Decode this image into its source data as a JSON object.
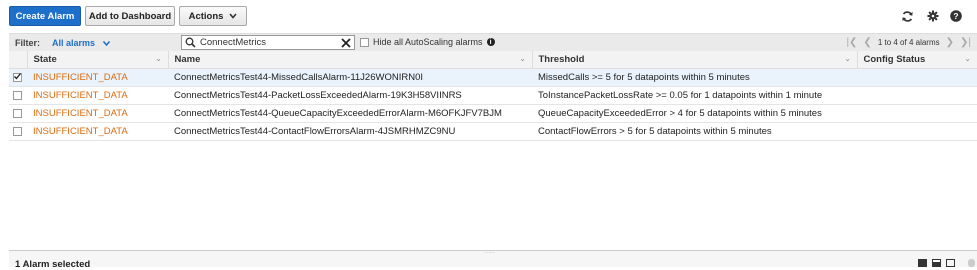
{
  "toolbar": {
    "create_alarm": "Create Alarm",
    "add_to_dashboard": "Add to Dashboard",
    "actions": "Actions",
    "icons": [
      "refresh-icon",
      "gear-icon",
      "help-icon"
    ]
  },
  "filter": {
    "label": "Filter:",
    "selected": "All alarms",
    "search_value": "ConnectMetrics",
    "hide_autoscaling_label": "Hide all AutoScaling alarms",
    "pager_text": "1 to 4 of 4 alarms"
  },
  "table": {
    "columns": [
      "State",
      "Name",
      "Threshold",
      "Config Status"
    ],
    "rows": [
      {
        "checked": true,
        "state": "INSUFFICIENT_DATA",
        "name": "ConnectMetricsTest44-MissedCallsAlarm-11J26WONIRN0I",
        "threshold": "MissedCalls >= 5 for 5 datapoints within 5 minutes",
        "config_status": ""
      },
      {
        "checked": false,
        "state": "INSUFFICIENT_DATA",
        "name": "ConnectMetricsTest44-PacketLossExceededAlarm-19K3H58VIINRS",
        "threshold": "ToInstancePacketLossRate >= 0.05 for 1 datapoints within 1 minute",
        "config_status": ""
      },
      {
        "checked": false,
        "state": "INSUFFICIENT_DATA",
        "name": "ConnectMetricsTest44-QueueCapacityExceededErrorAlarm-M6OFKJFV7BJM",
        "threshold": "QueueCapacityExceededError > 4 for 5 datapoints within 5 minutes",
        "config_status": ""
      },
      {
        "checked": false,
        "state": "INSUFFICIENT_DATA",
        "name": "ConnectMetricsTest44-ContactFlowErrorsAlarm-4JSMRHMZC9NU",
        "threshold": "ContactFlowErrors > 5 for 5 datapoints within 5 minutes",
        "config_status": ""
      }
    ]
  },
  "status": {
    "selected_text": "1 Alarm selected"
  },
  "colors": {
    "primary": "#1d6fc9",
    "state_warning": "#dd6b10",
    "selected_row": "#eaf3fc"
  }
}
